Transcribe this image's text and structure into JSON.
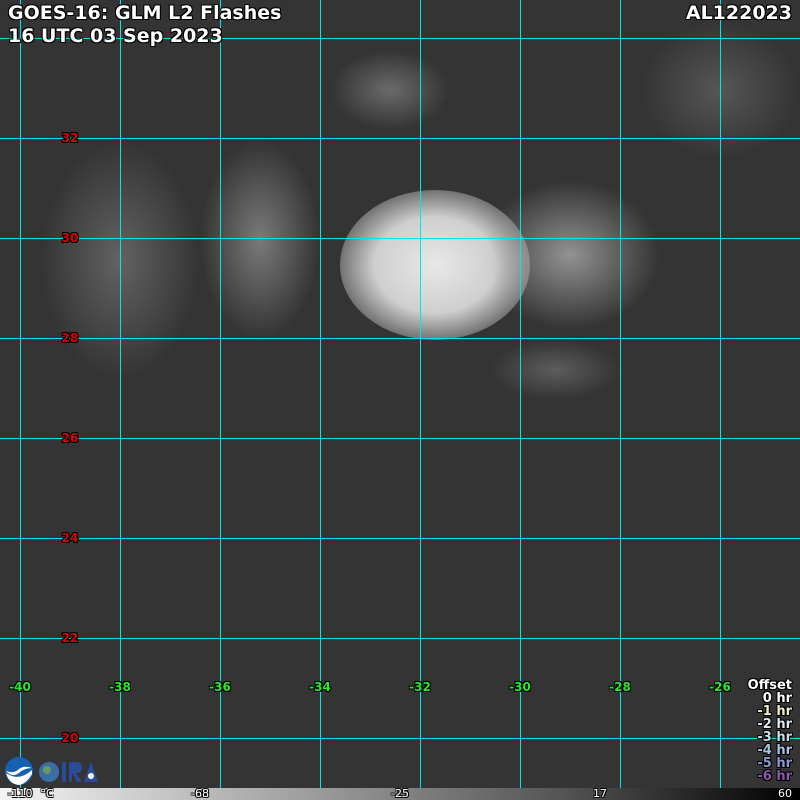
{
  "header": {
    "title": "GOES-16: GLM L2 Flashes",
    "datetime": "16 UTC 03 Sep 2023",
    "storm_id": "AL122023"
  },
  "grid": {
    "color": "#00e5ee",
    "latitudes": [
      "32",
      "30",
      "28",
      "26",
      "24",
      "22",
      "20"
    ],
    "longitudes": [
      "-40",
      "-38",
      "-36",
      "-34",
      "-32",
      "-30",
      "-28",
      "-26"
    ]
  },
  "legend": {
    "title": "Offset",
    "items": [
      {
        "label": "0 hr",
        "color": "#ffffff"
      },
      {
        "label": "-1 hr",
        "color": "#f4f0c8"
      },
      {
        "label": "-2 hr",
        "color": "#e0e8f0"
      },
      {
        "label": "-3 hr",
        "color": "#c8dcec"
      },
      {
        "label": "-4 hr",
        "color": "#a8c4e4"
      },
      {
        "label": "-5 hr",
        "color": "#9098d0"
      },
      {
        "label": "-6 hr",
        "color": "#8a5cb0"
      }
    ]
  },
  "colorbar": {
    "labels": [
      "-110",
      "°C",
      "-68",
      "-25",
      "17",
      "60"
    ]
  },
  "logos": {
    "noaa": "NOAA",
    "cira": "CIRA"
  }
}
